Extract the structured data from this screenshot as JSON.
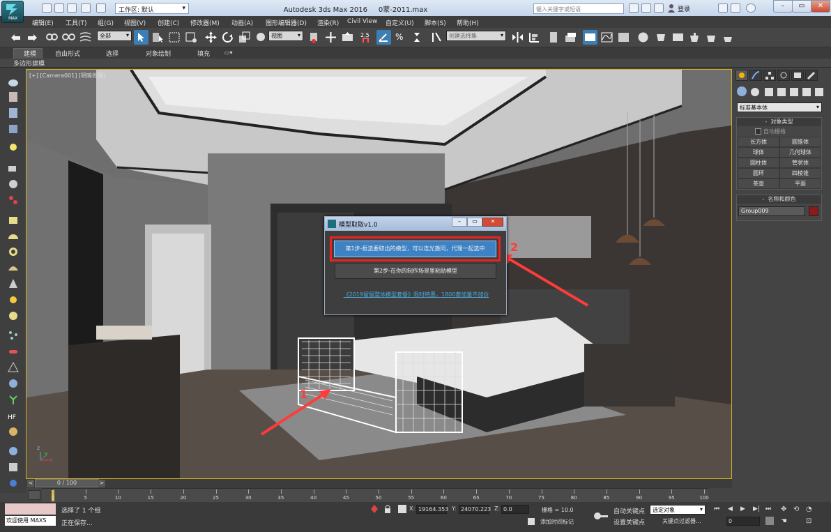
{
  "title_bar": {
    "app_title": "Autodesk 3ds Max 2016",
    "file_name": "0蒙-2011.max",
    "workspace": "工作区: 默认",
    "search_placeholder": "键入关键字或短语",
    "login": "登录",
    "max_logo": "MAX"
  },
  "menu": [
    "编辑(E)",
    "工具(T)",
    "组(G)",
    "视图(V)",
    "创建(C)",
    "修改器(M)",
    "动画(A)",
    "图形编辑器(D)",
    "渲染(R)",
    "Civil View",
    "自定义(U)",
    "脚本(S)",
    "帮助(H)"
  ],
  "toolbar": {
    "selection_filter": "全部",
    "reference_coord": "视图",
    "snap_value": "2.5",
    "named_selection": "创建选择集"
  },
  "ribbon": {
    "tabs": [
      "建模",
      "自由形式",
      "选择",
      "对象绘制",
      "填充"
    ],
    "sub_label": "多边形建模"
  },
  "viewport": {
    "label": "[+] [Camera001] [明暗处理]",
    "annotation_1": "1",
    "annotation_2": "2",
    "axis_x": "x",
    "axis_y": "y",
    "axis_z": "z"
  },
  "dialog": {
    "title": "模型取取v1.0",
    "step1": "第1步-框选要取出的模型，可以连光盏同，代理一起选中",
    "step2": "第2步-在你的制作场景里粘贴模型",
    "link": "《2019留留整体模型套餐》限时特惠，1800套加量不加价"
  },
  "command_panel": {
    "category": "标准基本体",
    "object_type_header": "对象类型",
    "auto_grid": "自动栅格",
    "buttons": [
      "长方体",
      "圆锥体",
      "球体",
      "几何球体",
      "圆柱体",
      "管状体",
      "圆环",
      "四棱锥",
      "茶壶",
      "平面"
    ],
    "name_color_header": "名称和颜色",
    "object_name": "Group009",
    "object_color": "#8b1a1a"
  },
  "timeline": {
    "frame_counter": "0 / 100",
    "ticks": [
      "0",
      "5",
      "10",
      "15",
      "20",
      "25",
      "30",
      "35",
      "40",
      "45",
      "50",
      "55",
      "60",
      "65",
      "70",
      "75",
      "80",
      "85",
      "90",
      "95",
      "100"
    ]
  },
  "status": {
    "selection_info": "选择了 1 个组",
    "progress_text": "正在保存...",
    "welcome": "欢迎使用 MAXS",
    "x_label": "X:",
    "x_value": "19164.353",
    "y_label": "Y:",
    "y_value": "24070.223",
    "z_label": "Z:",
    "z_value": "0.0",
    "grid": "栅格 = 10.0",
    "add_time_tag": "添加时间标记",
    "auto_key": "自动关键点",
    "set_key": "设置关键点",
    "key_mode": "选定对象",
    "key_filters": "关键点过滤器...",
    "current_frame": "0"
  }
}
